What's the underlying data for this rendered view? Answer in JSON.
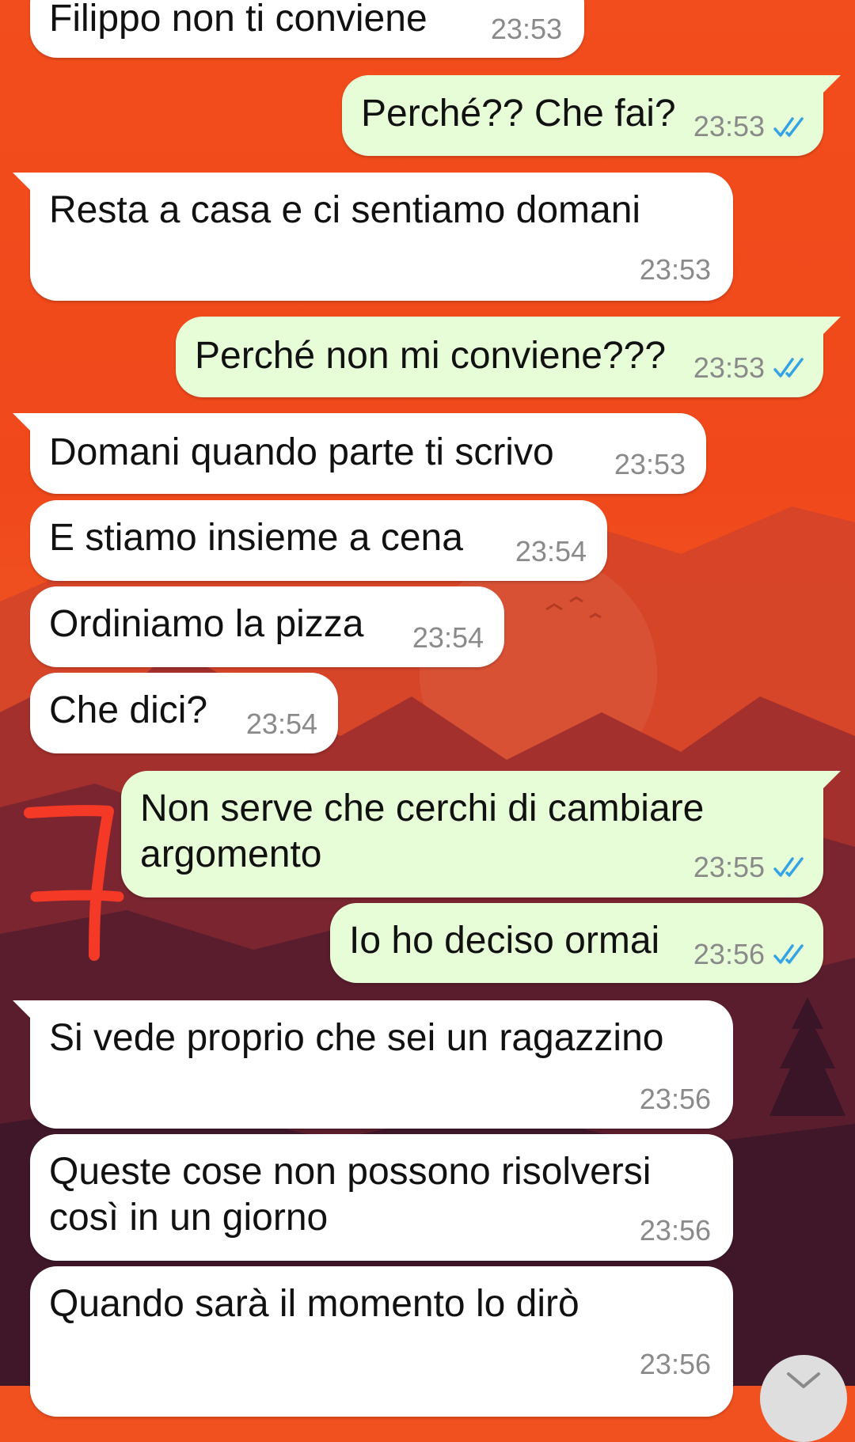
{
  "colors": {
    "outgoing_bubble": "#e7fdd7",
    "incoming_bubble": "#ffffff",
    "read_ticks": "#34a3e4",
    "annotation": "#f43a26"
  },
  "messages": [
    {
      "direction": "in",
      "text": "Filippo non ti conviene",
      "time": "23:53"
    },
    {
      "direction": "out",
      "text": "Perché?? Che fai?",
      "time": "23:53",
      "status": "read"
    },
    {
      "direction": "in",
      "text": "Resta a casa e ci sentiamo domani",
      "time": "23:53"
    },
    {
      "direction": "out",
      "text": "Perché non mi conviene???",
      "time": "23:53",
      "status": "read"
    },
    {
      "direction": "in",
      "text": "Domani quando parte ti scrivo",
      "time": "23:53"
    },
    {
      "direction": "in",
      "text": "E stiamo insieme a cena",
      "time": "23:54"
    },
    {
      "direction": "in",
      "text": "Ordiniamo la pizza",
      "time": "23:54"
    },
    {
      "direction": "in",
      "text": "Che dici?",
      "time": "23:54"
    },
    {
      "direction": "out",
      "text": "Non serve che cerchi di cambiare",
      "text2": "argomento",
      "time": "23:55",
      "status": "read"
    },
    {
      "direction": "out",
      "text": "Io ho deciso ormai",
      "time": "23:56",
      "status": "read"
    },
    {
      "direction": "in",
      "text": "Si vede proprio che sei un ragazzino",
      "time": "23:56"
    },
    {
      "direction": "in",
      "text": "Queste cose non possono risolversi",
      "text2": "così in un giorno",
      "time": "23:56"
    },
    {
      "direction": "in",
      "text": "Quando sarà il momento lo dirò",
      "time": "23:56"
    }
  ],
  "annotation": {
    "icon": "handwritten-seven-icon"
  },
  "scroll_button": {
    "icon": "chevron-down-icon"
  }
}
